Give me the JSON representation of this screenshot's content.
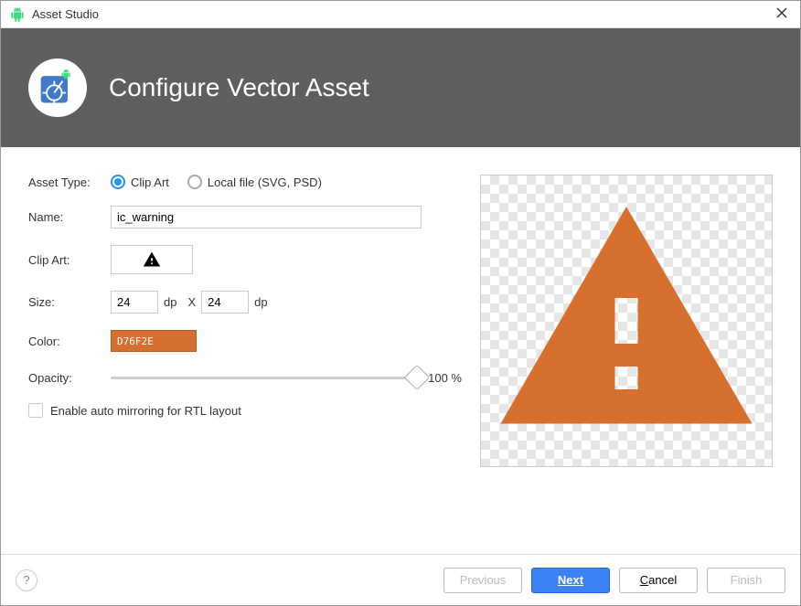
{
  "window": {
    "title": "Asset Studio"
  },
  "banner": {
    "title": "Configure Vector Asset"
  },
  "form": {
    "assetTypeLabel": "Asset Type:",
    "assetType": {
      "clipArt": "Clip Art",
      "localFile": "Local file (SVG, PSD)",
      "selected": "clipArt"
    },
    "nameLabel": "Name:",
    "nameValue": "ic_warning",
    "clipArtLabel": "Clip Art:",
    "sizeLabel": "Size:",
    "sizeWidth": "24",
    "sizeHeight": "24",
    "sizeUnit": "dp",
    "sizeSep": "X",
    "colorLabel": "Color:",
    "colorValue": "D76F2E",
    "opacityLabel": "Opacity:",
    "opacityValue": 100,
    "opacityDisplay": "100 %",
    "rtlLabel": "Enable auto mirroring for RTL layout",
    "rtlChecked": false
  },
  "footer": {
    "previous": "Previous",
    "next": "Next",
    "cancel": "Cancel",
    "finish": "Finish"
  }
}
